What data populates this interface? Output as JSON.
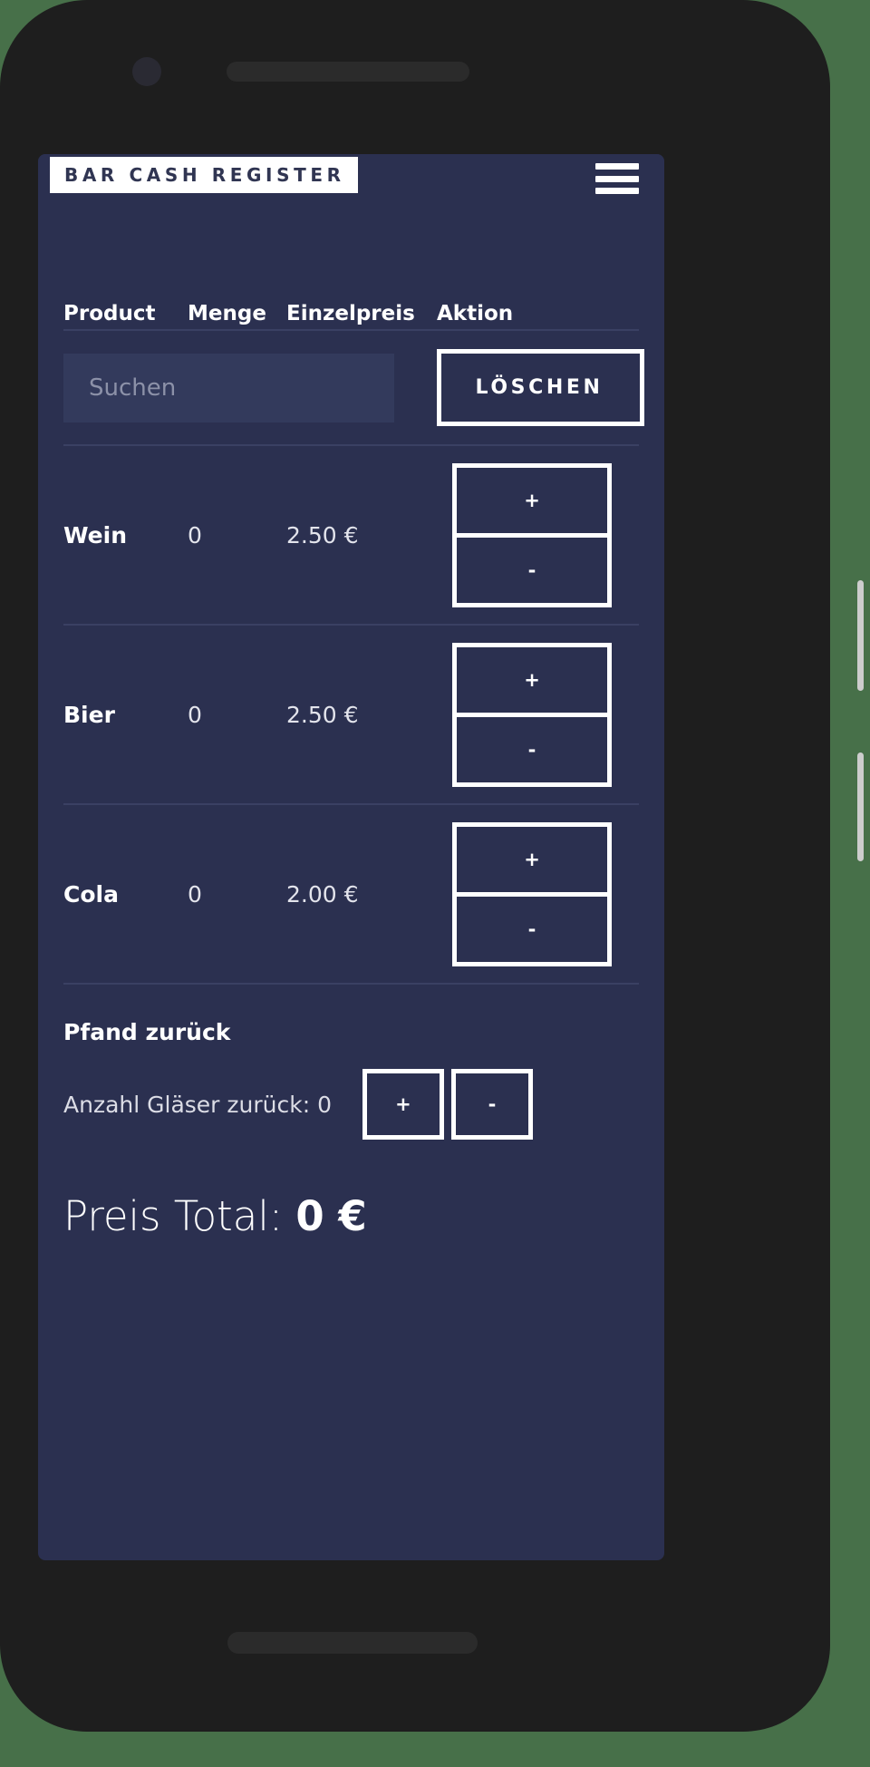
{
  "app": {
    "title": "BAR CASH REGISTER",
    "menu_icon": "hamburger-menu-icon"
  },
  "table": {
    "headers": {
      "product": "Product",
      "menge": "Menge",
      "einzelpreis": "Einzelpreis",
      "aktion": "Aktion"
    },
    "search": {
      "value": "",
      "placeholder": "Suchen"
    },
    "delete_label": "LÖSCHEN",
    "rows": [
      {
        "name": "Wein",
        "qty": "0",
        "price": "2.50 €",
        "plus": "+",
        "minus": "-"
      },
      {
        "name": "Bier",
        "qty": "0",
        "price": "2.50 €",
        "plus": "+",
        "minus": "-"
      },
      {
        "name": "Cola",
        "qty": "0",
        "price": "2.00 €",
        "plus": "+",
        "minus": "-"
      }
    ]
  },
  "pfand": {
    "title": "Pfand zurück",
    "count_label": "Anzahl Gläser zurück: 0",
    "plus": "+",
    "minus": "-"
  },
  "total": {
    "label": "Preis Total: ",
    "value": "0 €"
  },
  "colors": {
    "screen_background": "#2b3050",
    "accent_white": "#ffffff",
    "title_text": "#303552",
    "row_divider": "#3a4063",
    "search_field": "#333a5c",
    "placeholder_text": "#8c91a8",
    "phone_body": "#1e1e1e",
    "page_background": "#477049"
  }
}
